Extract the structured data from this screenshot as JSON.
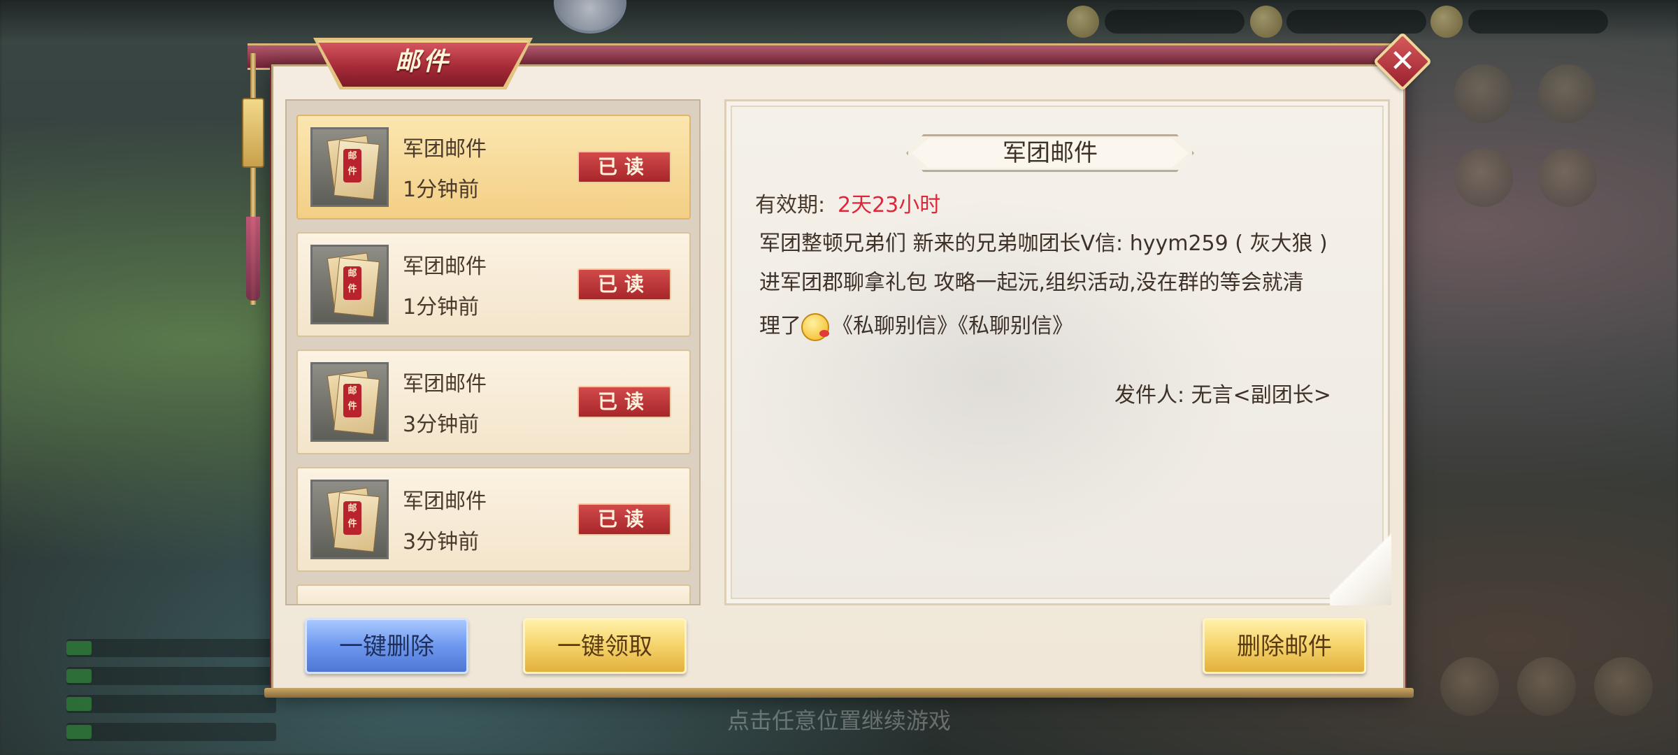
{
  "dialog": {
    "title": "邮件",
    "close_icon": "close-x-icon"
  },
  "mail_list": [
    {
      "title": "军团邮件",
      "time": "1分钟前",
      "status": "已读",
      "selected": true
    },
    {
      "title": "军团邮件",
      "time": "1分钟前",
      "status": "已读",
      "selected": false
    },
    {
      "title": "军团邮件",
      "time": "3分钟前",
      "status": "已读",
      "selected": false
    },
    {
      "title": "军团邮件",
      "time": "3分钟前",
      "status": "已读",
      "selected": false
    }
  ],
  "buttons": {
    "delete_all": "一键删除",
    "claim_all": "一键领取",
    "delete_mail": "删除邮件"
  },
  "detail": {
    "title": "军团邮件",
    "expiry_label": "有效期:",
    "expiry_value": "2天23小时",
    "body_line1": "军团整顿兄弟们  新来的兄弟咖团长V信: hyym259 ( 灰大狼 )",
    "body_line2": "进军团郡聊拿礼包 攻略一起沅,组织活动,没在群的等会就清",
    "body_line3_prefix": "理了",
    "body_line3_suffix": "《私聊别信》《私聊别信》",
    "emoji_icon": "smiley-emoji-icon",
    "sender": "发件人: 无言<副团长>"
  },
  "background": {
    "hint": "点击任意位置继续游戏"
  },
  "colors": {
    "accent_red": "#a52b37",
    "expiry_red": "#e0263a",
    "gold": "#f5d36a",
    "blue": "#6e98ef"
  }
}
